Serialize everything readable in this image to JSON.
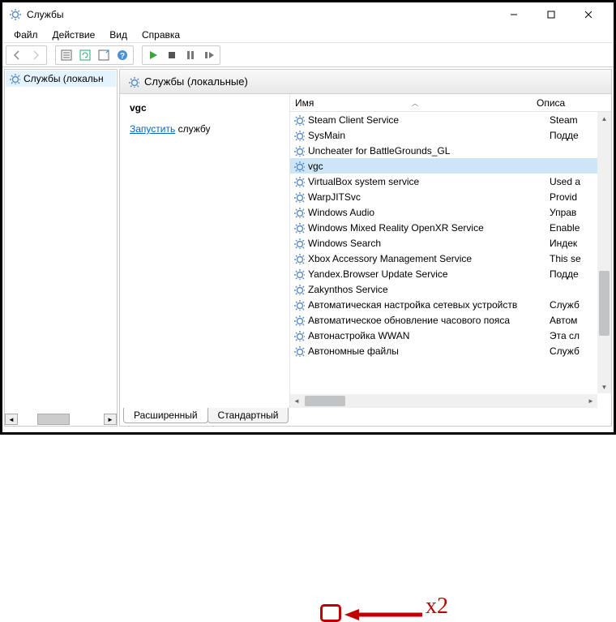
{
  "titlebar": {
    "title": "Службы"
  },
  "menu": {
    "file": "Файл",
    "action": "Действие",
    "view": "Вид",
    "help": "Справка"
  },
  "tree": {
    "item": "Службы (локальн"
  },
  "panel": {
    "header": "Службы (локальные)"
  },
  "action": {
    "name": "vgc",
    "link": "Запустить",
    "rest": " службу"
  },
  "columns": {
    "name": "Имя",
    "desc": "Описа"
  },
  "tabs": {
    "ext": "Расширенный",
    "std": "Стандартный"
  },
  "annotation": {
    "label": "x2"
  },
  "services": [
    {
      "name": "Steam Client Service",
      "desc": "Steam"
    },
    {
      "name": "SysMain",
      "desc": "Подде"
    },
    {
      "name": "Uncheater for BattleGrounds_GL",
      "desc": ""
    },
    {
      "name": "vgc",
      "desc": "",
      "selected": true
    },
    {
      "name": "VirtualBox system service",
      "desc": "Used a"
    },
    {
      "name": "WarpJITSvc",
      "desc": "Provid"
    },
    {
      "name": "Windows Audio",
      "desc": "Управ"
    },
    {
      "name": "Windows Mixed Reality OpenXR Service",
      "desc": "Enable"
    },
    {
      "name": "Windows Search",
      "desc": "Индек"
    },
    {
      "name": "Xbox Accessory Management Service",
      "desc": "This se"
    },
    {
      "name": "Yandex.Browser Update Service",
      "desc": "Подде"
    },
    {
      "name": "Zakynthos Service",
      "desc": ""
    },
    {
      "name": "Автоматическая настройка сетевых устройств",
      "desc": "Служб"
    },
    {
      "name": "Автоматическое обновление часового пояса",
      "desc": "Автом"
    },
    {
      "name": "Автонастройка WWAN",
      "desc": "Эта сл"
    },
    {
      "name": "Автономные файлы",
      "desc": "Служб"
    }
  ]
}
